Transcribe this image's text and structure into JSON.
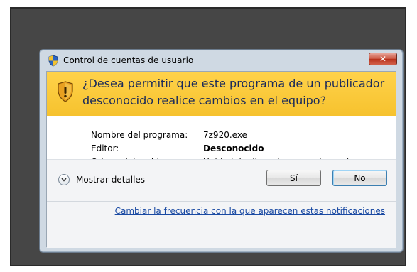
{
  "window": {
    "title": "Control de cuentas de usuario",
    "close_symbol": "✕"
  },
  "banner": {
    "line1": "¿Desea permitir que este programa de un publicador",
    "line2": "desconocido realice cambios en el equipo?"
  },
  "details": {
    "program_label": "Nombre del programa:",
    "program_value": "7z920.exe",
    "publisher_label": "Editor:",
    "publisher_value": "Desconocido",
    "origin_label": "Origen del archivo:",
    "origin_value": "Unidad de disco duro en este equipo"
  },
  "footer": {
    "show_details_label": "Mostrar detalles",
    "yes_label": "Sí",
    "no_label": "No",
    "change_link": "Cambiar la frecuencia con la que aparecen estas notificaciones"
  },
  "icons": {
    "title": "uac-shield-icon",
    "banner": "warning-shield-icon",
    "expander": "chevron-down-icon",
    "close": "close-icon"
  },
  "colors": {
    "banner": "#f6c22e",
    "link": "#1a4aa3",
    "close": "#c9503b"
  }
}
